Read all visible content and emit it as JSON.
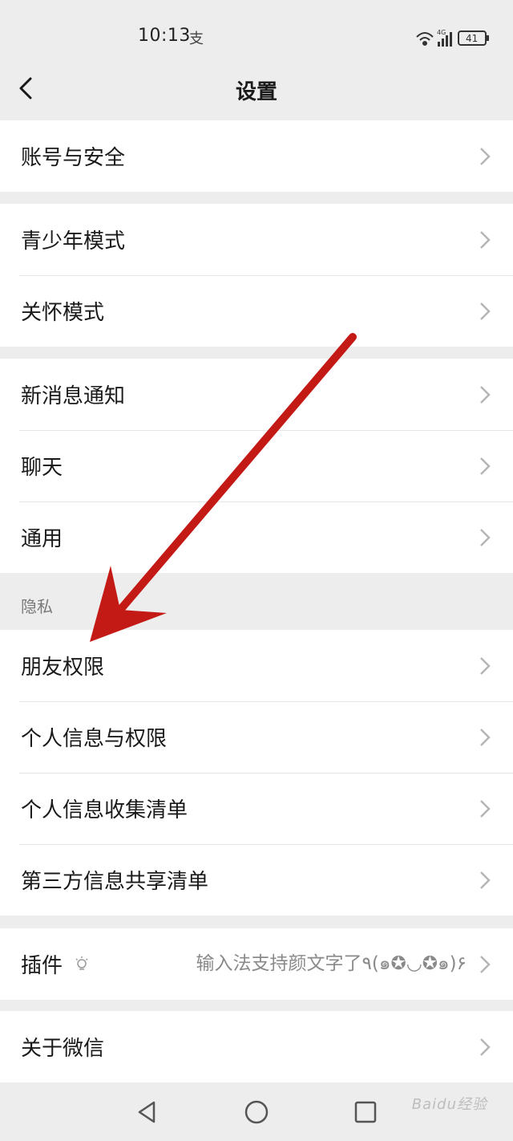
{
  "status_bar": {
    "time": "10:13",
    "extra": "支",
    "network": "4G",
    "battery": "41"
  },
  "header": {
    "title": "设置"
  },
  "groups": [
    {
      "items": [
        {
          "label": "账号与安全"
        }
      ]
    },
    {
      "items": [
        {
          "label": "青少年模式"
        },
        {
          "label": "关怀模式"
        }
      ]
    },
    {
      "items": [
        {
          "label": "新消息通知"
        },
        {
          "label": "聊天"
        },
        {
          "label": "通用"
        }
      ]
    },
    {
      "section": "隐私",
      "items": [
        {
          "label": "朋友权限"
        },
        {
          "label": "个人信息与权限"
        },
        {
          "label": "个人信息收集清单"
        },
        {
          "label": "第三方信息共享清单"
        }
      ]
    },
    {
      "items": [
        {
          "label": "插件",
          "hint": "输入法支持颜文字了٩(๑✪◡✪๑)۶"
        }
      ]
    },
    {
      "items": [
        {
          "label": "关于微信"
        }
      ]
    }
  ],
  "watermark": "Baidu经验",
  "colors": {
    "background": "#ededed",
    "card": "#ffffff",
    "arrow": "#c41a16"
  }
}
